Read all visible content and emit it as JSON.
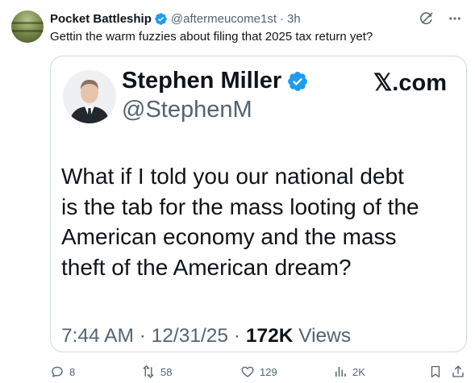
{
  "post": {
    "author": {
      "display_name": "Pocket Battleship",
      "handle": "@aftermeucome1st",
      "separator": "·",
      "time": "3h",
      "verified": true
    },
    "text": "Gettin the warm fuzzies about filing that 2025 tax return yet?"
  },
  "quoted_image": {
    "author_name": "Stephen Miller",
    "author_handle": "@StephenM",
    "brand": "𝕏.com",
    "text_lines": [
      "What if I told you our national debt",
      "is the tab for the mass looting of the",
      "American economy and the mass",
      "theft of the American dream?"
    ],
    "timestamp": "7:44 AM · 12/31/25 · ",
    "views_count": "172K",
    "views_label": " Views"
  },
  "actions": {
    "reply_count": "8",
    "repost_count": "58",
    "like_count": "129",
    "views_count": "2K"
  },
  "colors": {
    "text_primary": "#0f1419",
    "text_secondary": "#536471",
    "verified_blue": "#1d9bf0",
    "border": "#cfd9de"
  }
}
